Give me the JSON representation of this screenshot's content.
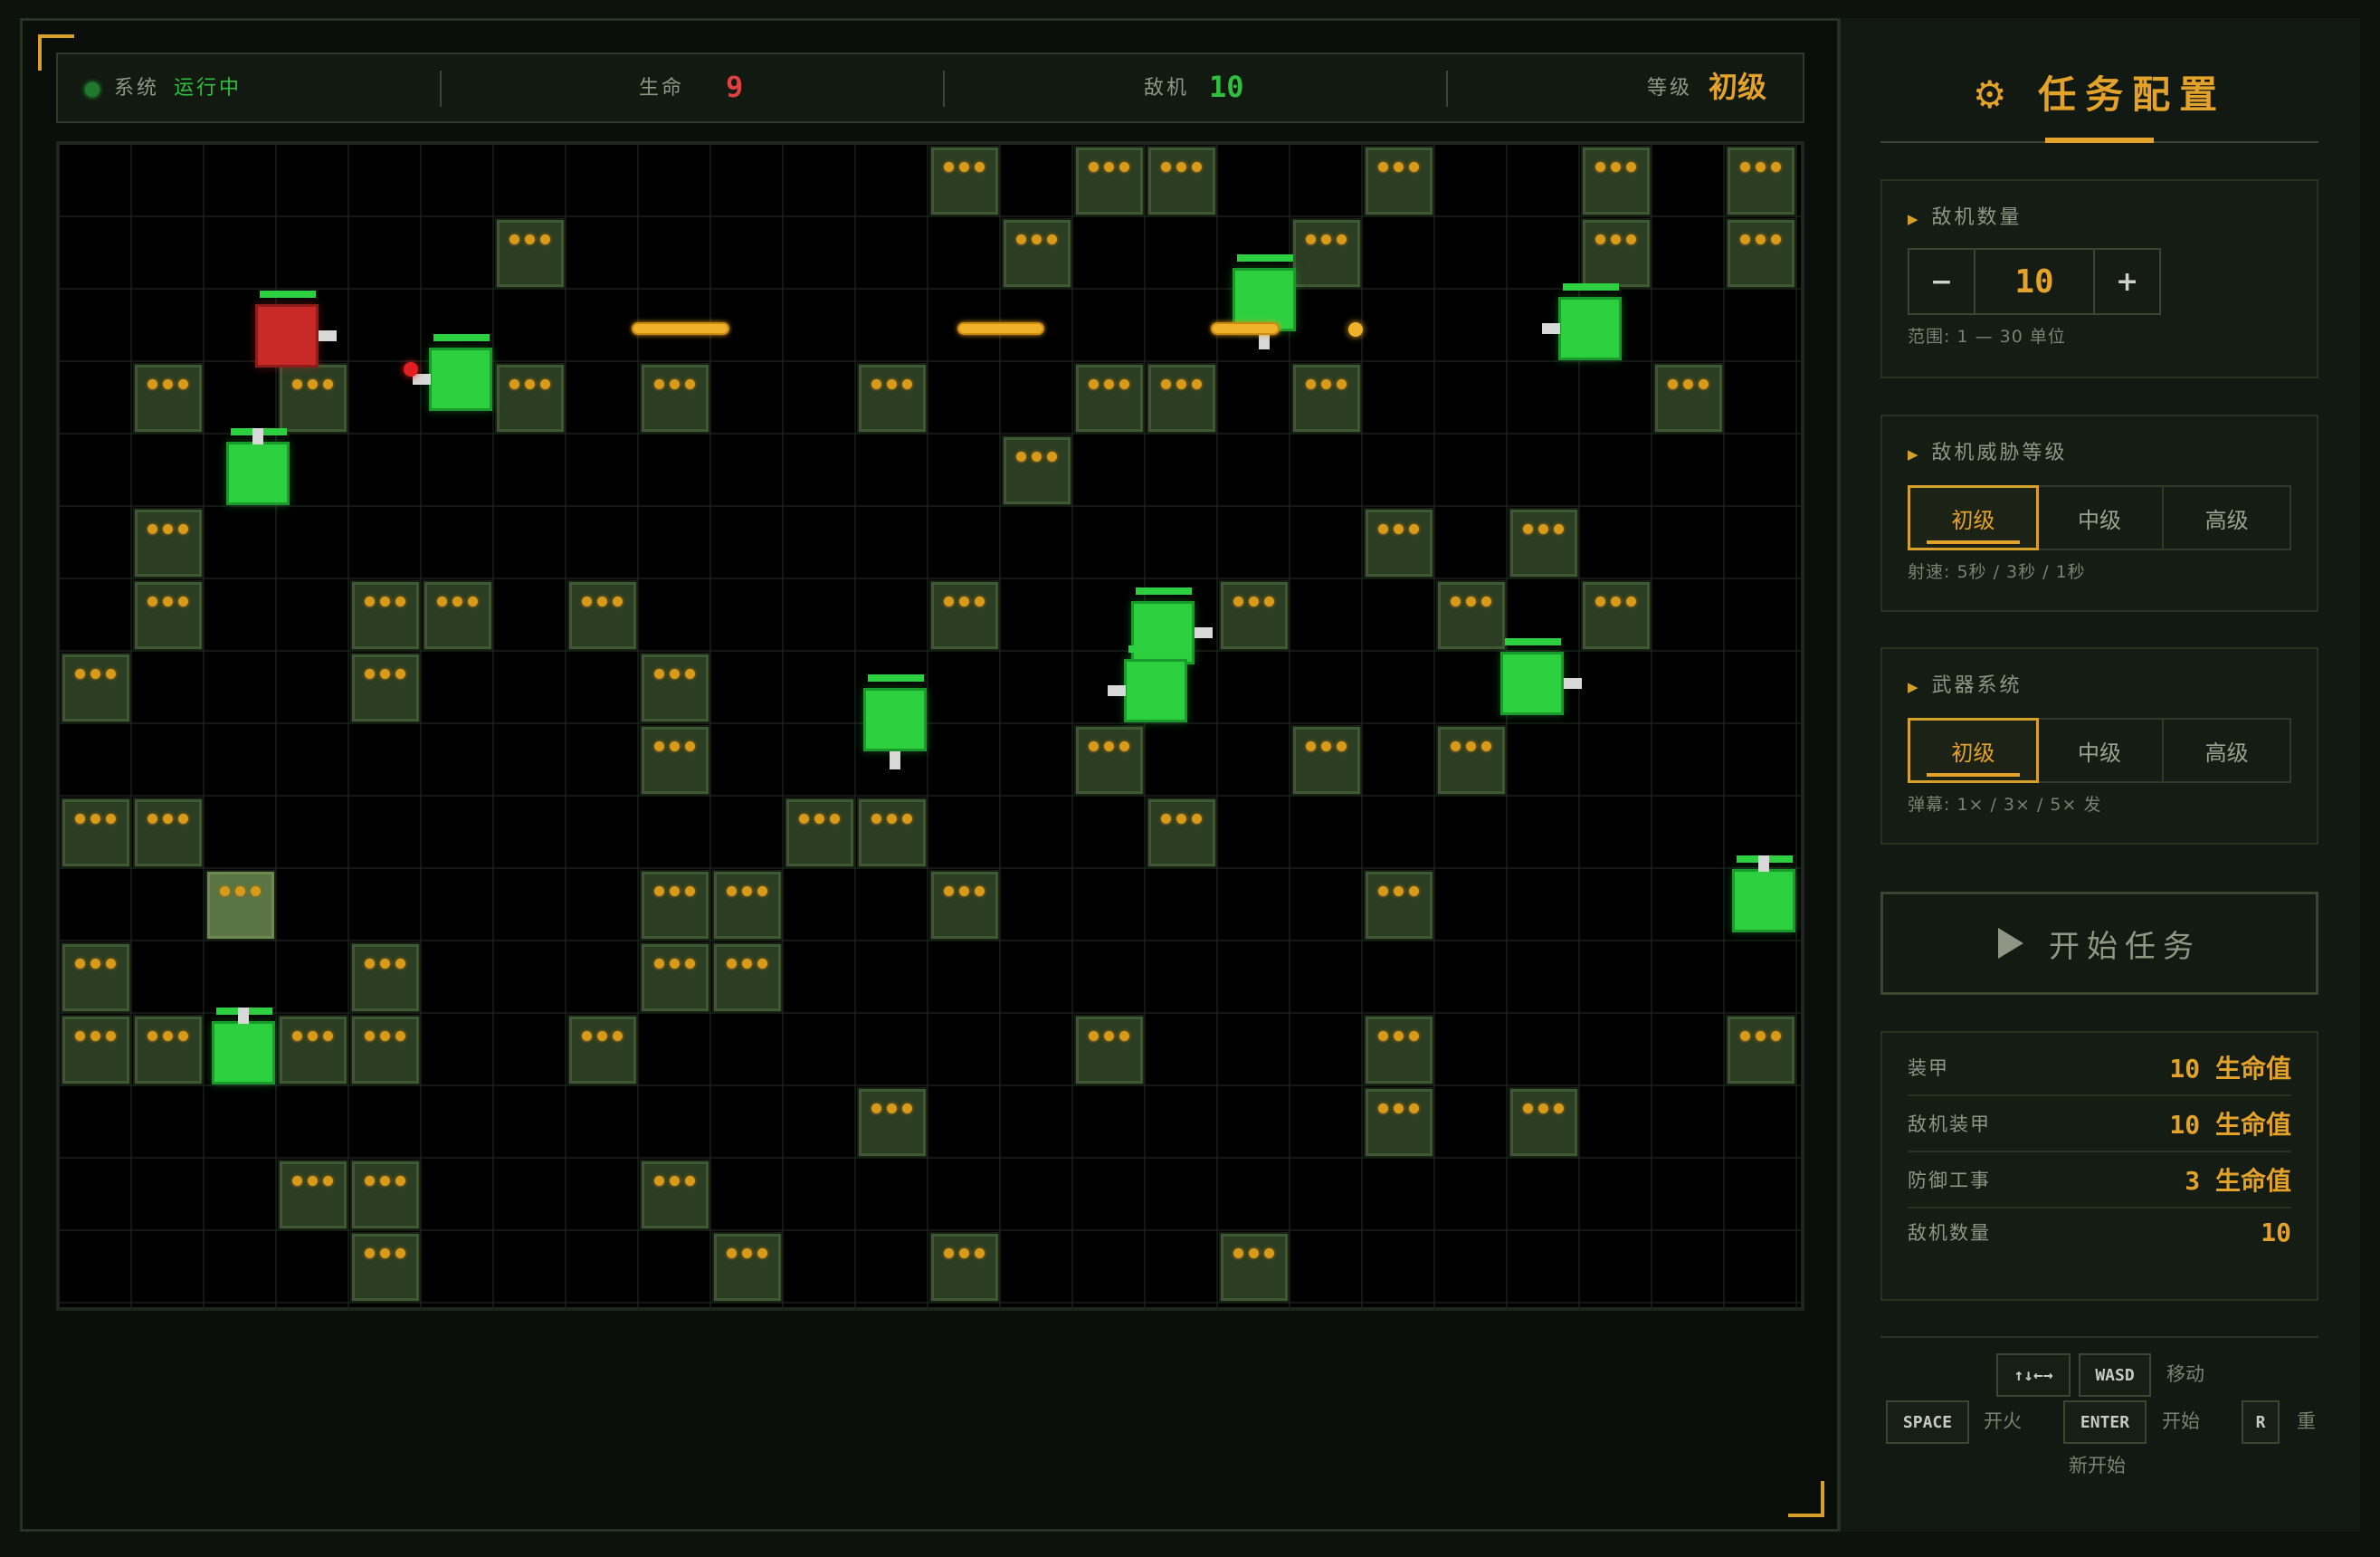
{
  "status": {
    "system_label": "系统",
    "system_value": "运行中",
    "lives_label": "生命",
    "lives_value": "9",
    "enemies_label": "敌机",
    "enemies_value": "10",
    "level_label": "等级",
    "level_value": "初级"
  },
  "board": {
    "cols": 24,
    "rows": 16,
    "walls": [
      [
        12,
        0
      ],
      [
        14,
        0
      ],
      [
        15,
        0
      ],
      [
        18,
        0
      ],
      [
        21,
        0
      ],
      [
        23,
        0
      ],
      [
        6,
        1
      ],
      [
        13,
        1
      ],
      [
        17,
        1
      ],
      [
        21,
        1
      ],
      [
        23,
        1
      ],
      [
        1,
        3
      ],
      [
        3,
        3
      ],
      [
        6,
        3
      ],
      [
        8,
        3
      ],
      [
        11,
        3
      ],
      [
        14,
        3
      ],
      [
        15,
        3
      ],
      [
        17,
        3
      ],
      [
        22,
        3
      ],
      [
        13,
        4
      ],
      [
        1,
        5
      ],
      [
        18,
        5
      ],
      [
        20,
        5
      ],
      [
        1,
        6
      ],
      [
        4,
        6
      ],
      [
        5,
        6
      ],
      [
        7,
        6
      ],
      [
        12,
        6
      ],
      [
        16,
        6
      ],
      [
        19,
        6
      ],
      [
        21,
        6
      ],
      [
        0,
        7
      ],
      [
        4,
        7
      ],
      [
        8,
        7
      ],
      [
        8,
        8
      ],
      [
        14,
        8
      ],
      [
        17,
        8
      ],
      [
        19,
        8
      ],
      [
        0,
        9
      ],
      [
        1,
        9
      ],
      [
        10,
        9
      ],
      [
        11,
        9
      ],
      [
        15,
        9
      ],
      [
        8,
        10
      ],
      [
        9,
        10
      ],
      [
        12,
        10
      ],
      [
        18,
        10
      ],
      [
        0,
        11
      ],
      [
        4,
        11
      ],
      [
        8,
        11
      ],
      [
        9,
        11
      ],
      [
        0,
        12
      ],
      [
        1,
        12
      ],
      [
        3,
        12
      ],
      [
        4,
        12
      ],
      [
        7,
        12
      ],
      [
        14,
        12
      ],
      [
        18,
        12
      ],
      [
        23,
        12
      ],
      [
        11,
        13
      ],
      [
        18,
        13
      ],
      [
        20,
        13
      ],
      [
        3,
        14
      ],
      [
        4,
        14
      ],
      [
        8,
        14
      ],
      [
        4,
        15
      ],
      [
        9,
        15
      ],
      [
        12,
        15
      ],
      [
        16,
        15
      ]
    ],
    "damaged_walls": [
      [
        2,
        10
      ]
    ],
    "player": {
      "col": 2.7,
      "row": 2.2,
      "facing": "right"
    },
    "enemies": [
      {
        "col": 5.1,
        "row": 2.8,
        "facing": "left"
      },
      {
        "col": 2.3,
        "row": 4.1,
        "facing": "up"
      },
      {
        "col": 16.2,
        "row": 1.7,
        "facing": "down"
      },
      {
        "col": 20.7,
        "row": 2.1,
        "facing": "left"
      },
      {
        "col": 14.8,
        "row": 6.3,
        "facing": "right"
      },
      {
        "col": 14.7,
        "row": 7.1,
        "facing": "left"
      },
      {
        "col": 11.1,
        "row": 7.5,
        "facing": "down"
      },
      {
        "col": 19.9,
        "row": 7.0,
        "facing": "right"
      },
      {
        "col": 23.1,
        "row": 10.0,
        "facing": "up"
      },
      {
        "col": 2.1,
        "row": 12.1,
        "facing": "up"
      }
    ],
    "bullets": [
      {
        "col": 7.9,
        "row": 2.45,
        "len": 1.35
      },
      {
        "col": 12.4,
        "row": 2.45,
        "len": 1.2
      },
      {
        "col": 15.9,
        "row": 2.45,
        "len": 0.95
      }
    ],
    "dots": [
      {
        "col": 4.75,
        "row": 3.0,
        "color": "#e02020"
      },
      {
        "col": 17.8,
        "row": 2.45,
        "color": "#f0b22a"
      }
    ]
  },
  "panel": {
    "title": "⚙ 任务配置",
    "count": {
      "label": "敌机数量",
      "minus": "−",
      "value": "10",
      "plus": "+",
      "hint": "范围: 1 — 30 单位"
    },
    "threat": {
      "label": "敌机威胁等级",
      "options": [
        "初级",
        "中级",
        "高级"
      ],
      "hint": "射速: 5秒 / 3秒 / 1秒"
    },
    "weapon": {
      "label": "武器系统",
      "options": [
        "初级",
        "中级",
        "高级"
      ],
      "hint": "弹幕: 1× / 3× / 5× 发"
    },
    "start_label": "开始任务",
    "stats": [
      {
        "k": "装甲",
        "v": "10 生命值"
      },
      {
        "k": "敌机装甲",
        "v": "10 生命值"
      },
      {
        "k": "防御工事",
        "v": "3 生命值"
      },
      {
        "k": "敌机数量",
        "v": "10"
      }
    ],
    "controls": {
      "arrows_key": "↑↓←→",
      "wasd_key": "WASD",
      "move_label": "移动",
      "space_key": "SPACE",
      "fire_label": "开火",
      "enter_key": "ENTER",
      "start_label": "开始",
      "r_key": "R",
      "restart_label_a": "重",
      "restart_label_b": "新开始"
    }
  },
  "colors": {
    "accent": "#e3a32a",
    "running": "#2fbf3f",
    "lives": "#e04040",
    "enemies": "#2fbf3f",
    "player_tank": "#c82a28",
    "enemy_tank": "#2dd13f",
    "wall": "#2b3d22"
  }
}
